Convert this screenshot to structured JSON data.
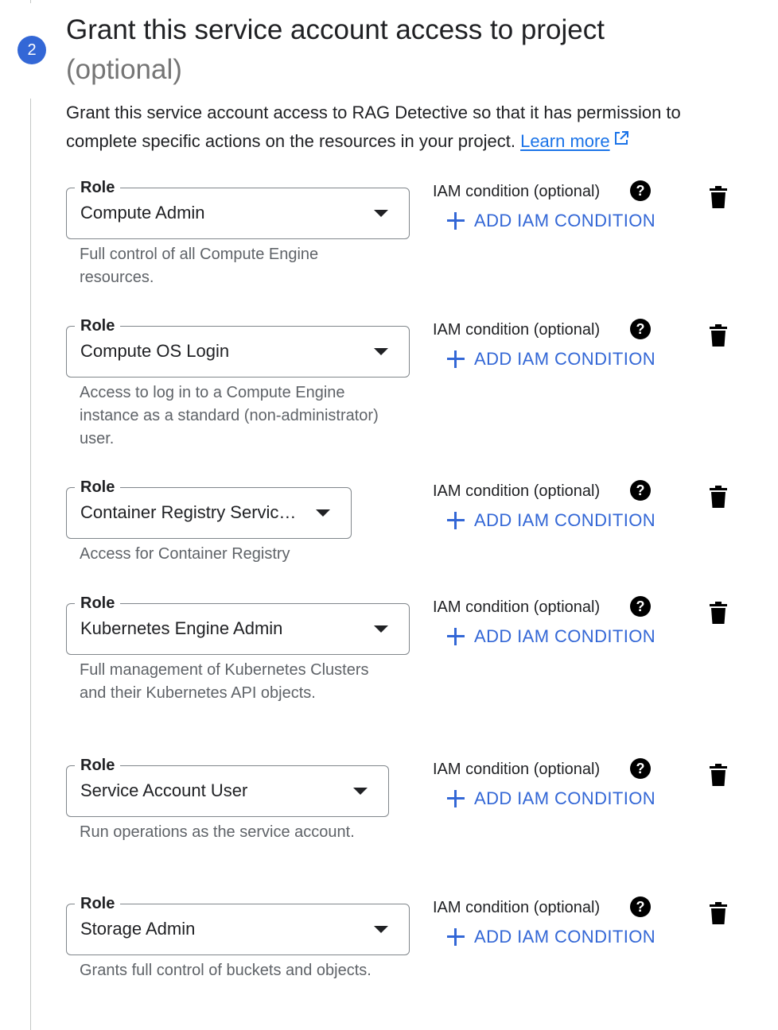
{
  "step": {
    "number": "2"
  },
  "header": {
    "title": "Grant this service account access to project",
    "subtitle": "(optional)"
  },
  "description": {
    "text": "Grant this service account access to RAG Detective so that it has permission to complete specific actions on the resources in your project.",
    "learn_more": "Learn more"
  },
  "colors": {
    "accent": "#3367d6",
    "text": "#202124",
    "muted": "#5f6368",
    "border": "#80868b"
  },
  "roles": [
    {
      "label": "Role",
      "value": "Compute Admin",
      "description": "Full control of all Compute Engine resources.",
      "iam_label": "IAM condition (optional)",
      "add_label": "ADD IAM CONDITION",
      "help_icon": "?"
    },
    {
      "label": "Role",
      "value": "Compute OS Login",
      "description": "Access to log in to a Compute Engine instance as a standard (non-administrator) user.",
      "iam_label": "IAM condition (optional)",
      "add_label": "ADD IAM CONDITION",
      "help_icon": "?"
    },
    {
      "label": "Role",
      "value": "Container Registry Servic…",
      "description": "Access for Container Registry",
      "iam_label": "IAM condition (optional)",
      "add_label": "ADD IAM CONDITION",
      "help_icon": "?"
    },
    {
      "label": "Role",
      "value": "Kubernetes Engine Admin",
      "description": "Full management of Kubernetes Clusters and their Kubernetes API objects.",
      "iam_label": "IAM condition (optional)",
      "add_label": "ADD IAM CONDITION",
      "help_icon": "?"
    },
    {
      "label": "Role",
      "value": "Service Account User",
      "description": "Run operations as the service account.",
      "iam_label": "IAM condition (optional)",
      "add_label": "ADD IAM CONDITION",
      "help_icon": "?"
    },
    {
      "label": "Role",
      "value": "Storage Admin",
      "description": "Grants full control of buckets and objects.",
      "iam_label": "IAM condition (optional)",
      "add_label": "ADD IAM CONDITION",
      "help_icon": "?"
    }
  ]
}
